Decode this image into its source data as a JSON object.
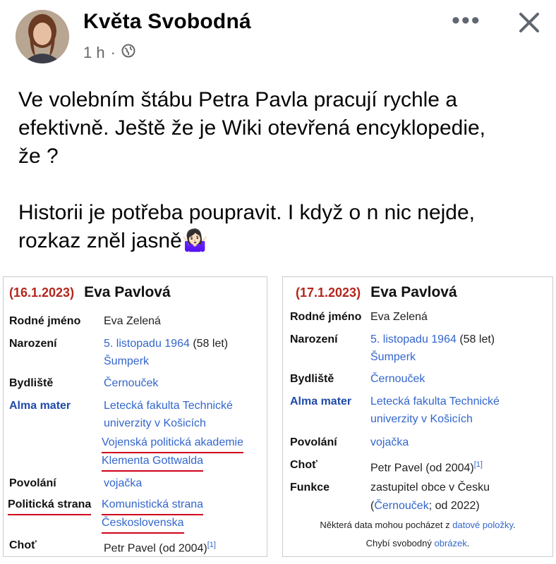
{
  "post": {
    "author": "Květa Svobodná",
    "time": "1 h",
    "sep": "·",
    "more": "•••",
    "lines": [
      "Ve volebním štábu Petra Pavla pracují rychle a",
      "efektivně. Ještě že je Wiki otevřená encyklopedie,",
      "že ?",
      "Historii je potřeba poupravit. I když o n nic nejde,",
      "rozkaz zněl jasně🤷🏻‍♀️"
    ]
  },
  "left": {
    "date": "(16.1.2023)",
    "name": "Eva Pavlová",
    "rows": {
      "rodne_label": "Rodné jméno",
      "rodne_val": "Eva Zelená",
      "narozeni_label": "Narození",
      "narozeni_pre": "5. listopadu ",
      "narozeni_year": "1964",
      "narozeni_post": " (58 let)",
      "narozeni_place": "Šumperk",
      "bydliste_label": "Bydliště",
      "bydliste_val": "Černouček",
      "alma_label": "Alma mater",
      "alma_1": "Letecká fakulta Technické",
      "alma_2": "univerzity v Košicích",
      "alma_3": "Vojenská politická akademie",
      "alma_4": "Klementa Gottwalda",
      "povolani_label": "Povolání",
      "povolani_val": "vojačka",
      "strana_label": "Politická strana",
      "strana_1": "Komunistická strana",
      "strana_2": "Československa",
      "chot_label": "Choť",
      "chot_val": "Petr Pavel (od 2004)",
      "chot_ref": "[1]"
    }
  },
  "right": {
    "date": "(17.1.2023)",
    "name": "Eva Pavlová",
    "rows": {
      "rodne_label": "Rodné jméno",
      "rodne_val": "Eva Zelená",
      "narozeni_label": "Narození",
      "narozeni_pre": "5. listopadu ",
      "narozeni_year": "1964",
      "narozeni_post": " (58 let)",
      "narozeni_place": "Šumperk",
      "bydliste_label": "Bydliště",
      "bydliste_val": "Černouček",
      "alma_label": "Alma mater",
      "alma_1": "Letecká fakulta Technické",
      "alma_2": "univerzity v Košicích",
      "povolani_label": "Povolání",
      "povolani_val": "vojačka",
      "chot_label": "Choť",
      "chot_val": "Petr Pavel (od 2004)",
      "chot_ref": "[1]",
      "funkce_label": "Funkce",
      "funkce_1": "zastupitel obce v Česku",
      "funkce_2a": "(",
      "funkce_2b": "Černouček",
      "funkce_2c": "; od 2022)",
      "foot1_a": "Některá data mohou pocházet z ",
      "foot1_b": "datové položky",
      "foot1_c": ".",
      "foot2_a": "Chybí svobodný ",
      "foot2_b": "obrázek",
      "foot2_c": "."
    }
  },
  "colors": {
    "accent_red": "#d0021b",
    "link": "#3366cc",
    "meta": "#65676b"
  }
}
